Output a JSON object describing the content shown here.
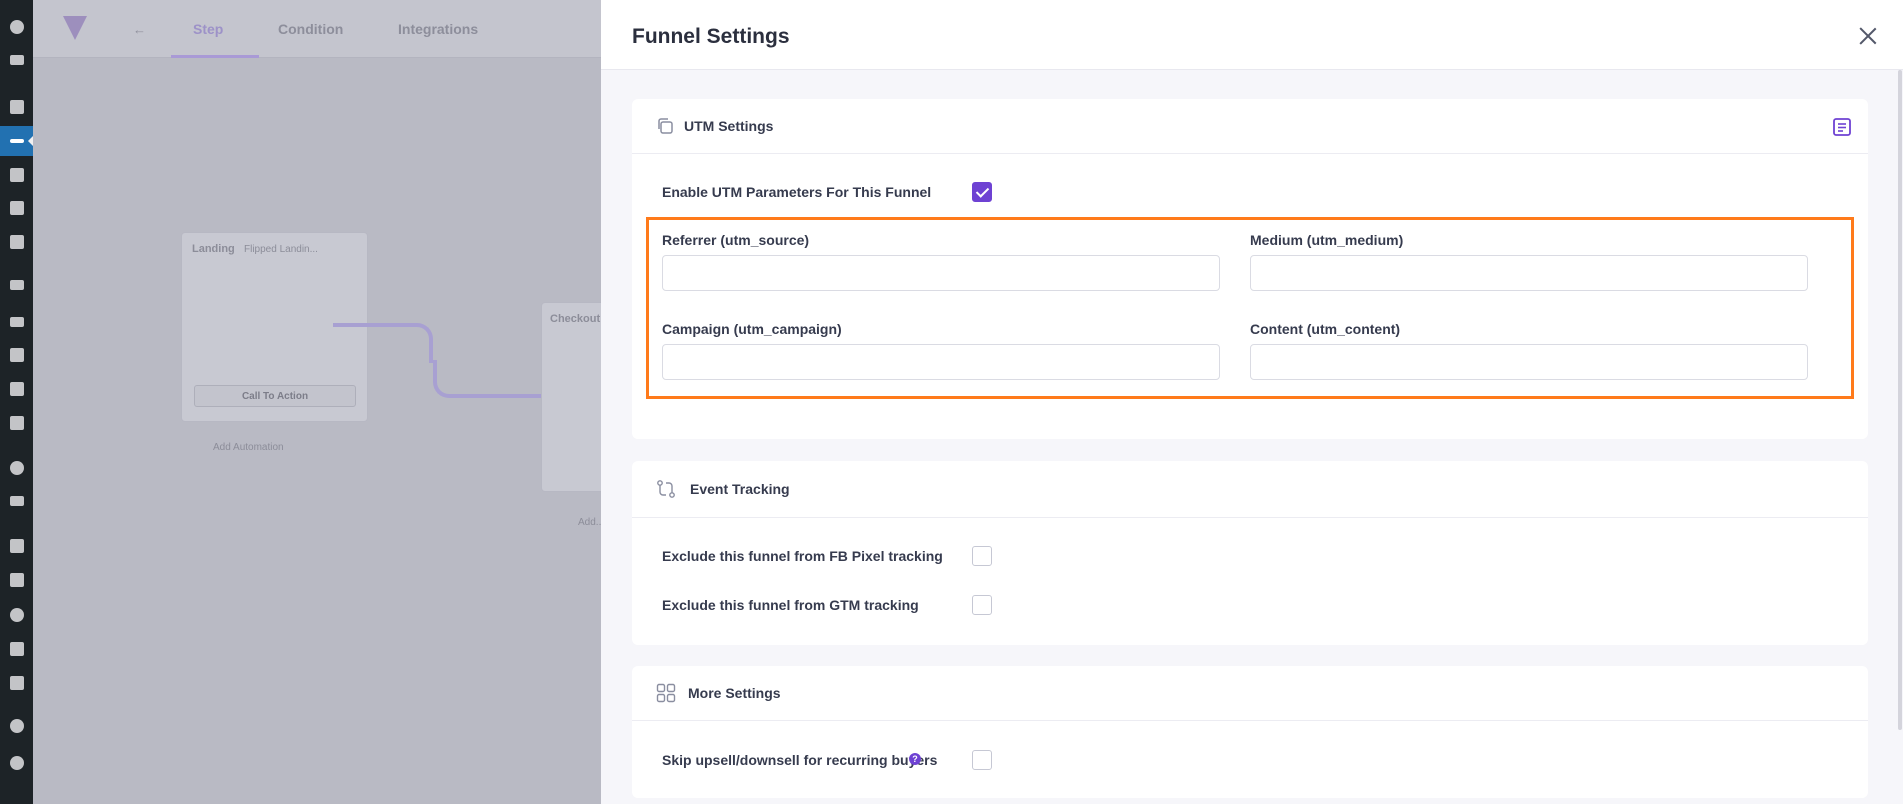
{
  "wp_sidebar": {
    "icons": [
      "dashboard-icon",
      "mail-icon",
      "pin-icon",
      "funnel-icon",
      "media-icon",
      "pages-icon",
      "comments-icon",
      "woo-icon",
      "products-icon",
      "payments-icon",
      "analytics-icon",
      "marketing-icon",
      "elementor-icon",
      "templates-icon",
      "appearance-icon",
      "plugins-icon",
      "users-icon",
      "tools-icon",
      "settings-icon",
      "mail-at-icon",
      "play-icon"
    ]
  },
  "builder": {
    "back_label": "←",
    "tabs": [
      "Step",
      "Condition",
      "Integrations"
    ],
    "nodes": {
      "landing_title": "Landing",
      "landing_subtitle": "Flipped Landin...",
      "landing_button": "Call To Action",
      "landing_footer": "Add Automation",
      "checkout_title": "Checkout",
      "checkout_footer": "Add..."
    }
  },
  "panel": {
    "title": "Funnel Settings",
    "utm": {
      "title": "UTM Settings",
      "enable_label": "Enable UTM Parameters For This Funnel",
      "enable_checked": true,
      "fields": {
        "source_label": "Referrer (utm_source)",
        "source_value": "",
        "medium_label": "Medium (utm_medium)",
        "medium_value": "",
        "campaign_label": "Campaign (utm_campaign)",
        "campaign_value": "",
        "content_label": "Content (utm_content)",
        "content_value": ""
      }
    },
    "event_tracking": {
      "title": "Event Tracking",
      "fb_pixel_label": "Exclude this funnel from FB Pixel tracking",
      "fb_pixel_checked": false,
      "gtm_label": "Exclude this funnel from GTM tracking",
      "gtm_checked": false
    },
    "more_settings": {
      "title": "More Settings",
      "skip_upsell_label": "Skip upsell/downsell for recurring buyers",
      "help_glyph": "?",
      "skip_upsell_checked": false
    }
  },
  "colors": {
    "accent": "#6e42d3",
    "highlight": "#ff7a1a",
    "wp_sidebar": "#1d2327",
    "wp_active": "#2271b1"
  }
}
